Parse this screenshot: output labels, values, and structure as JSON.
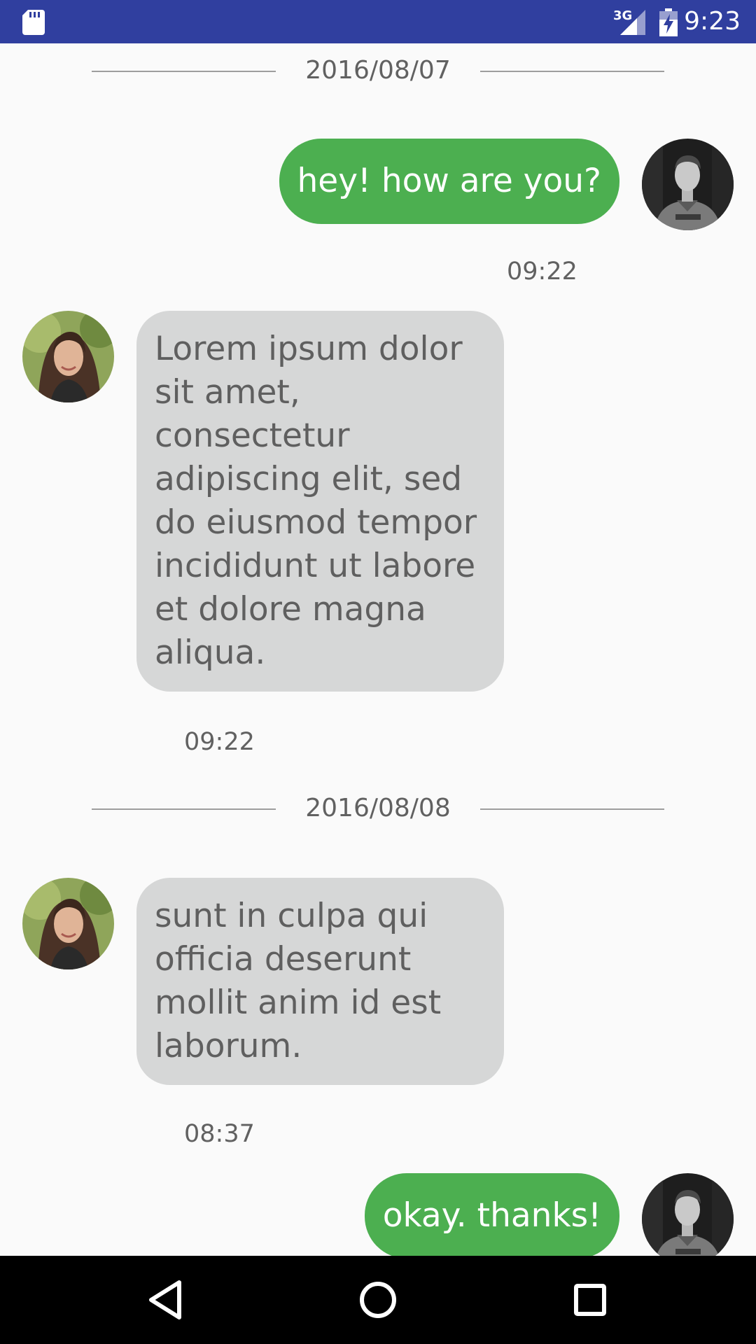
{
  "status_bar": {
    "network": "3G",
    "time": "9:23",
    "icons": [
      "sd-card-icon",
      "signal-icon",
      "battery-charging-icon"
    ]
  },
  "colors": {
    "status_bar": "#303f9f",
    "outgoing_bubble": "#4caf50",
    "incoming_bubble": "#d6d7d7",
    "background": "#fafafa",
    "nav_bar": "#000000"
  },
  "chat": {
    "date_separators": [
      "2016/08/07",
      "2016/08/08"
    ],
    "messages": [
      {
        "direction": "outgoing",
        "text": "hey! how are you?",
        "time": "09:22"
      },
      {
        "direction": "incoming",
        "text": "Lorem ipsum dolor sit amet, consectetur adipiscing elit, sed do eiusmod tempor incididunt ut labore et dolore magna aliqua.",
        "time": "09:22"
      },
      {
        "direction": "incoming",
        "text": "sunt in culpa qui officia deserunt mollit anim id est laborum.",
        "time": "08:37"
      },
      {
        "direction": "outgoing",
        "text": "okay. thanks!",
        "time": ""
      }
    ]
  },
  "nav_bar": {
    "icons": [
      "back-icon",
      "home-icon",
      "recents-icon"
    ]
  }
}
